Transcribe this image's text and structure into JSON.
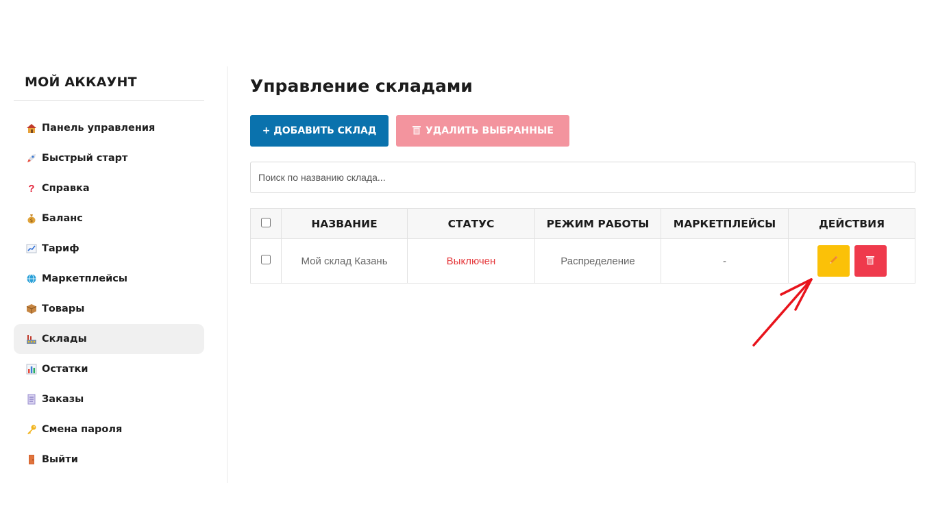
{
  "sidebar": {
    "title": "МОЙ АККАУНТ",
    "items": [
      {
        "label": "Панель управления",
        "icon": "house-icon"
      },
      {
        "label": "Быстрый старт",
        "icon": "rocket-icon"
      },
      {
        "label": "Справка",
        "icon": "question-icon"
      },
      {
        "label": "Баланс",
        "icon": "money-bag-icon"
      },
      {
        "label": "Тариф",
        "icon": "chart-up-icon"
      },
      {
        "label": "Маркетплейсы",
        "icon": "globe-icon"
      },
      {
        "label": "Товары",
        "icon": "package-icon"
      },
      {
        "label": "Склады",
        "icon": "factory-icon",
        "active": true
      },
      {
        "label": "Остатки",
        "icon": "bar-chart-icon"
      },
      {
        "label": "Заказы",
        "icon": "receipt-icon"
      },
      {
        "label": "Смена пароля",
        "icon": "key-icon"
      },
      {
        "label": "Выйти",
        "icon": "door-icon"
      }
    ]
  },
  "main": {
    "title": "Управление складами",
    "add_button": "+ ДОБАВИТЬ СКЛАД",
    "delete_selected_button": "УДАЛИТЬ ВЫБРАННЫЕ",
    "search_placeholder": "Поиск по названию склада...",
    "table": {
      "headers": [
        "НАЗВАНИЕ",
        "СТАТУС",
        "РЕЖИМ РАБОТЫ",
        "МАРКЕТПЛЕЙСЫ",
        "ДЕЙСТВИЯ"
      ],
      "rows": [
        {
          "name": "Мой склад Казань",
          "status": "Выключен",
          "mode": "Распределение",
          "marketplaces": "-"
        }
      ]
    }
  },
  "colors": {
    "primary": "#0a72ad",
    "danger_light": "#f3949e",
    "danger": "#ef3a4c",
    "warning": "#fbc108",
    "status_off": "#e5383b",
    "annotation_arrow": "#e8141c"
  }
}
